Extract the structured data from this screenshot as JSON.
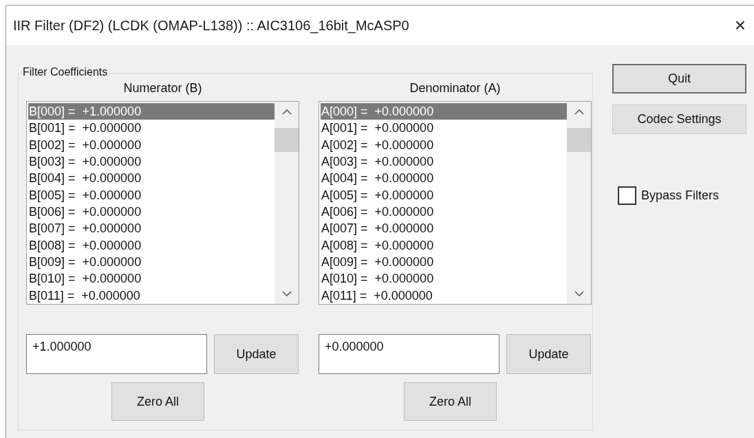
{
  "window": {
    "title": "IIR Filter (DF2) (LCDK (OMAP-L138)) :: AIC3106_16bit_McASP0",
    "close": "×"
  },
  "group": {
    "title": "Filter Coefficients",
    "panels": [
      {
        "label": "Numerator (B)",
        "items": [
          {
            "text": "B[000] =  +1.000000",
            "selected": true
          },
          {
            "text": "B[001] =  +0.000000",
            "selected": false
          },
          {
            "text": "B[002] =  +0.000000",
            "selected": false
          },
          {
            "text": "B[003] =  +0.000000",
            "selected": false
          },
          {
            "text": "B[004] =  +0.000000",
            "selected": false
          },
          {
            "text": "B[005] =  +0.000000",
            "selected": false
          },
          {
            "text": "B[006] =  +0.000000",
            "selected": false
          },
          {
            "text": "B[007] =  +0.000000",
            "selected": false
          },
          {
            "text": "B[008] =  +0.000000",
            "selected": false
          },
          {
            "text": "B[009] =  +0.000000",
            "selected": false
          },
          {
            "text": "B[010] =  +0.000000",
            "selected": false
          },
          {
            "text": "B[011] =  +0.000000",
            "selected": false
          }
        ],
        "value": "+1.000000",
        "update": "Update",
        "zero": "Zero All"
      },
      {
        "label": "Denominator (A)",
        "items": [
          {
            "text": "A[000] =  +0.000000",
            "selected": true
          },
          {
            "text": "A[001] =  +0.000000",
            "selected": false
          },
          {
            "text": "A[002] =  +0.000000",
            "selected": false
          },
          {
            "text": "A[003] =  +0.000000",
            "selected": false
          },
          {
            "text": "A[004] =  +0.000000",
            "selected": false
          },
          {
            "text": "A[005] =  +0.000000",
            "selected": false
          },
          {
            "text": "A[006] =  +0.000000",
            "selected": false
          },
          {
            "text": "A[007] =  +0.000000",
            "selected": false
          },
          {
            "text": "A[008] =  +0.000000",
            "selected": false
          },
          {
            "text": "A[009] =  +0.000000",
            "selected": false
          },
          {
            "text": "A[010] =  +0.000000",
            "selected": false
          },
          {
            "text": "A[011] =  +0.000000",
            "selected": false
          }
        ],
        "value": "+0.000000",
        "update": "Update",
        "zero": "Zero All"
      }
    ]
  },
  "buttons": [
    {
      "label": "Quit",
      "default": true
    },
    {
      "label": "Codec Settings",
      "default": false
    }
  ],
  "bypass": {
    "label": "Bypass Filters",
    "checked": false
  }
}
